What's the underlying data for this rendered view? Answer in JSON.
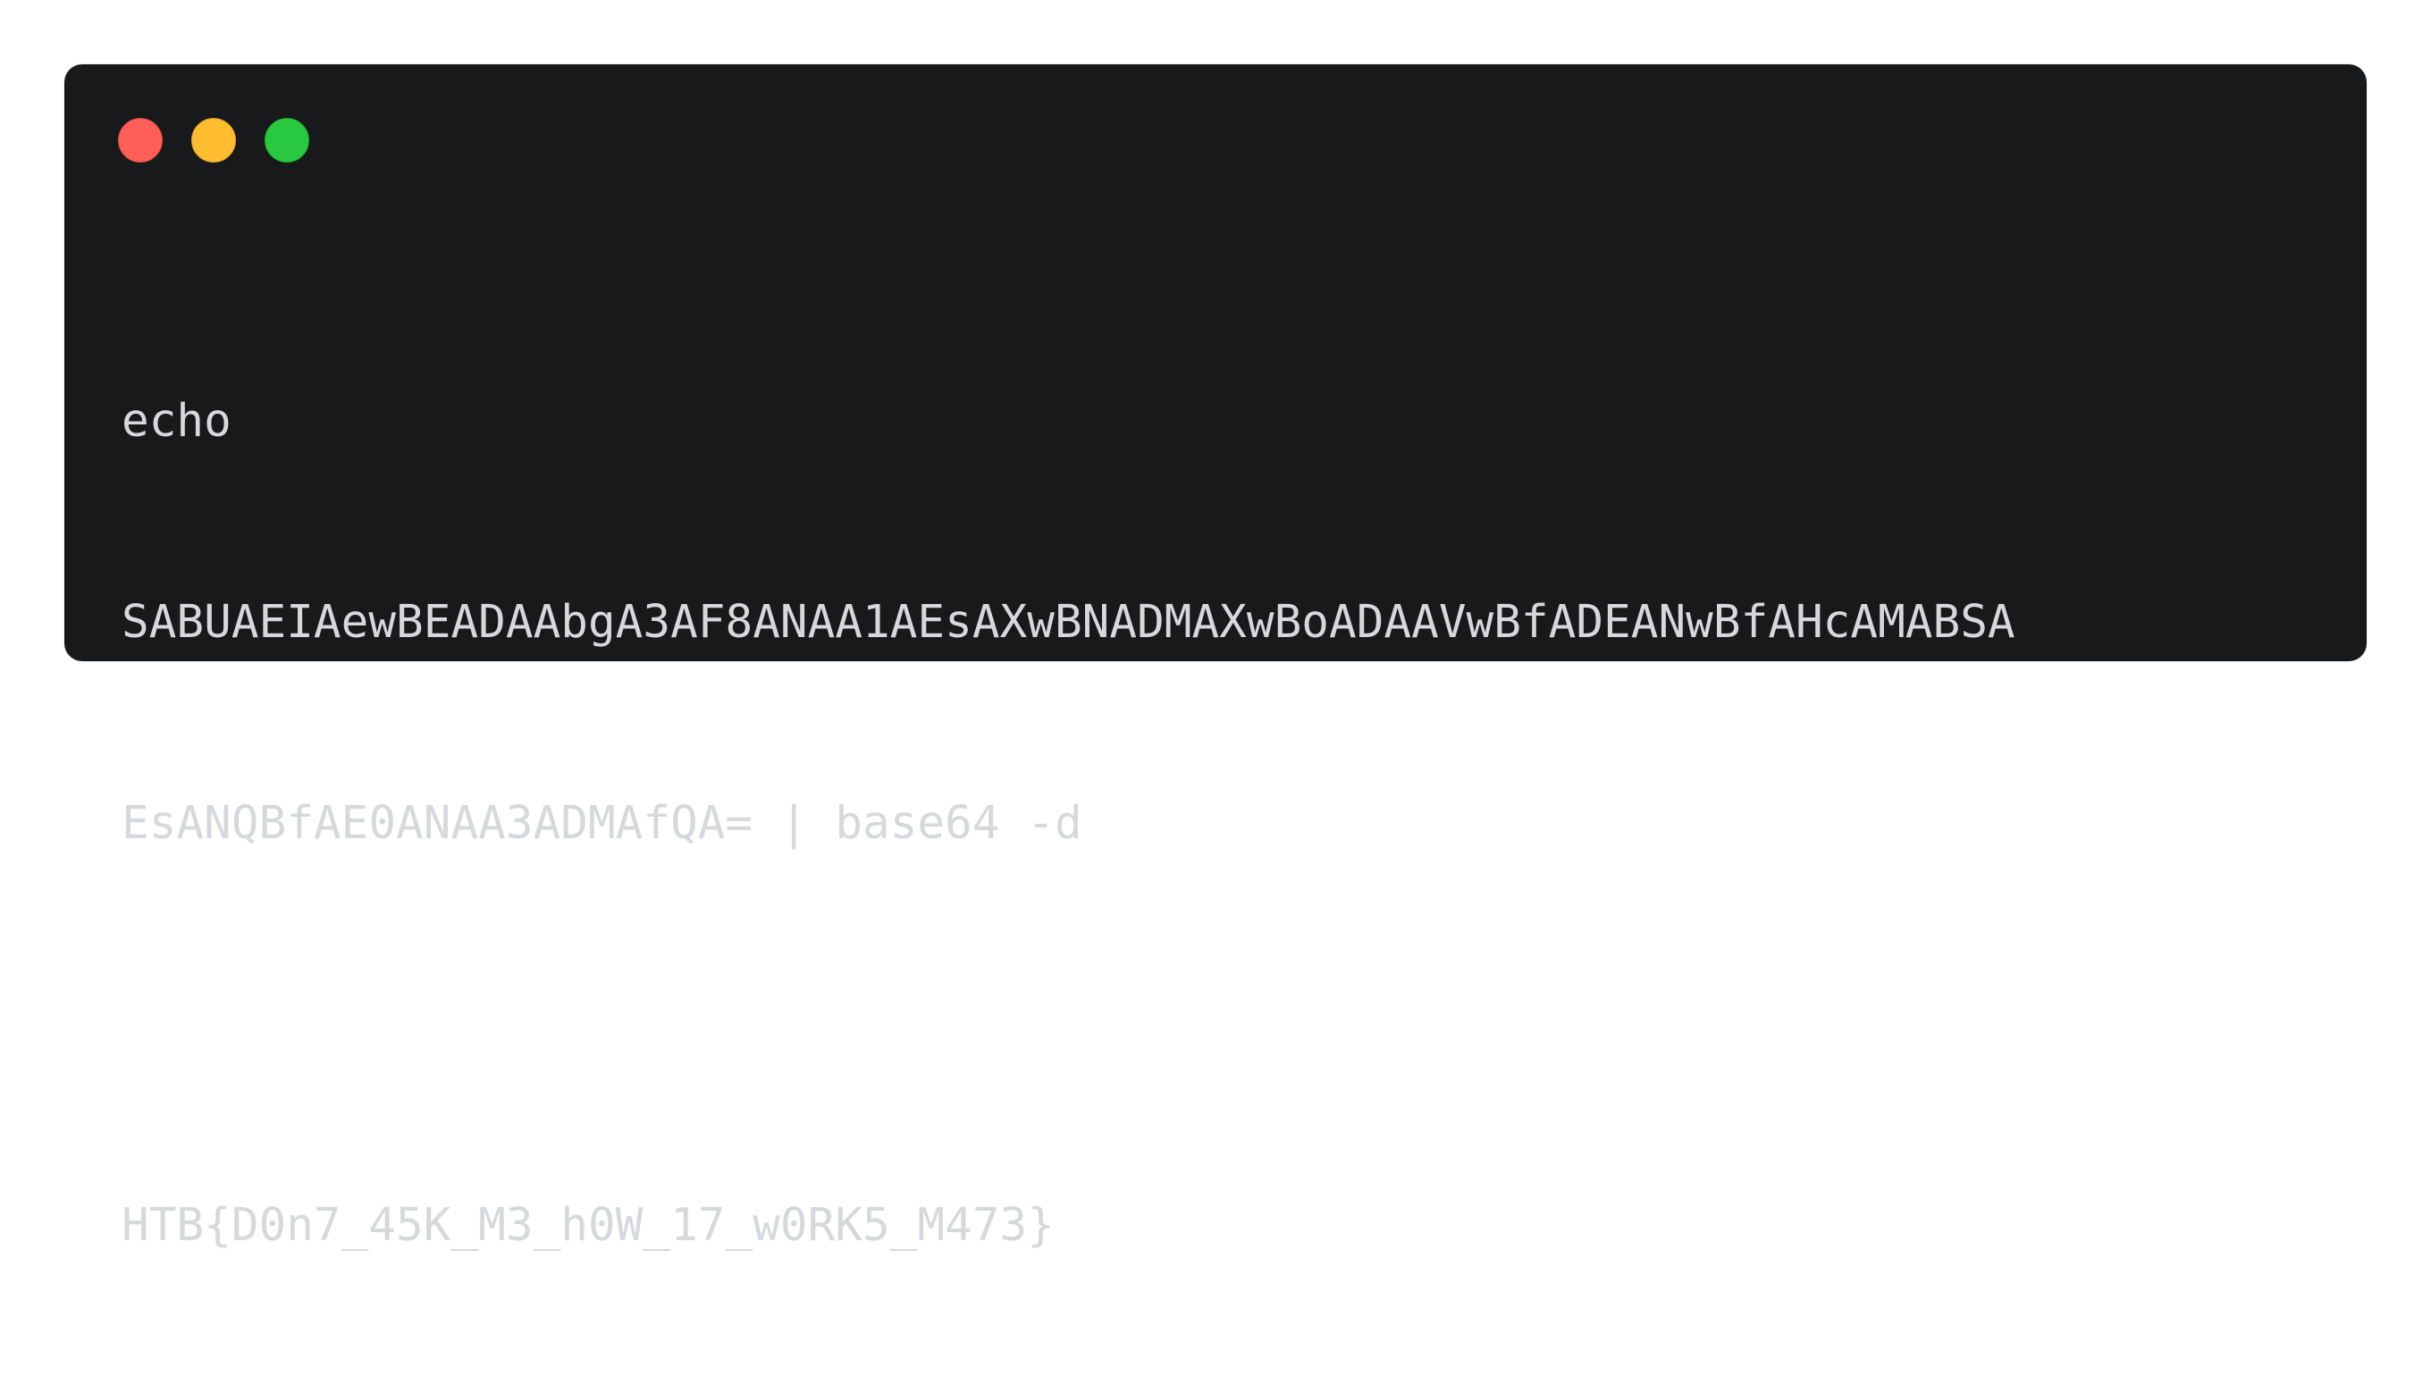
{
  "window": {
    "controls": [
      {
        "name": "close",
        "color": "#ff5f57"
      },
      {
        "name": "minimize",
        "color": "#febc2e"
      },
      {
        "name": "maximize",
        "color": "#28c840"
      }
    ]
  },
  "code": {
    "lines": [
      "echo",
      "SABUAEIAewBEADAAbgA3AF8ANAA1AEsAXwBNADMAXwBoADAAVwBfADEANwBfAHcAMABSA",
      "EsANQBfAE0ANAA3ADMAfQA= | base64 -d",
      "",
      "HTB{D0n7_45K_M3_h0W_17_w0RK5_M473}"
    ]
  }
}
